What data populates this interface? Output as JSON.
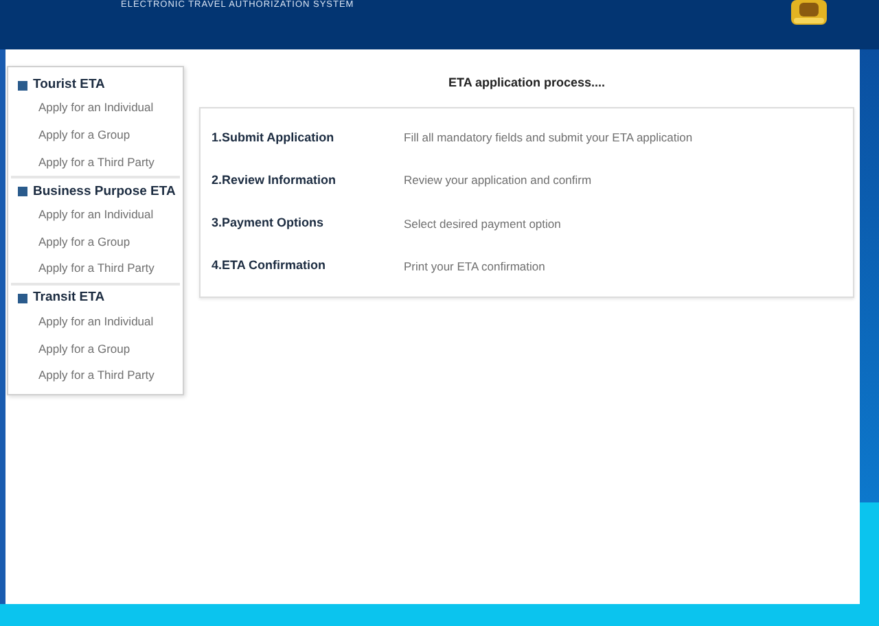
{
  "header": {
    "subtitle": "ELECTRONIC TRAVEL AUTHORIZATION SYSTEM"
  },
  "sidebar": {
    "sections": [
      {
        "title": "Tourist ETA",
        "items": [
          "Apply for an Individual",
          "Apply for a Group",
          "Apply for a Third Party"
        ]
      },
      {
        "title": "Business Purpose ETA",
        "items": [
          "Apply for an Individual",
          "Apply for a Group",
          "Apply for a Third Party"
        ]
      },
      {
        "title": "Transit ETA",
        "items": [
          "Apply for an Individual",
          "Apply for a Group",
          "Apply for a Third Party"
        ]
      }
    ]
  },
  "process": {
    "title": "ETA application process....",
    "steps": [
      {
        "step": "1.Submit Application",
        "description": "Fill all mandatory fields and submit your ETA application"
      },
      {
        "step": "2.Review Information",
        "description": "Review your application and confirm"
      },
      {
        "step": "3.Payment Options",
        "description": "Select desired payment option"
      },
      {
        "step": "4.ETA Confirmation",
        "description": "Print your ETA confirmation"
      }
    ]
  }
}
